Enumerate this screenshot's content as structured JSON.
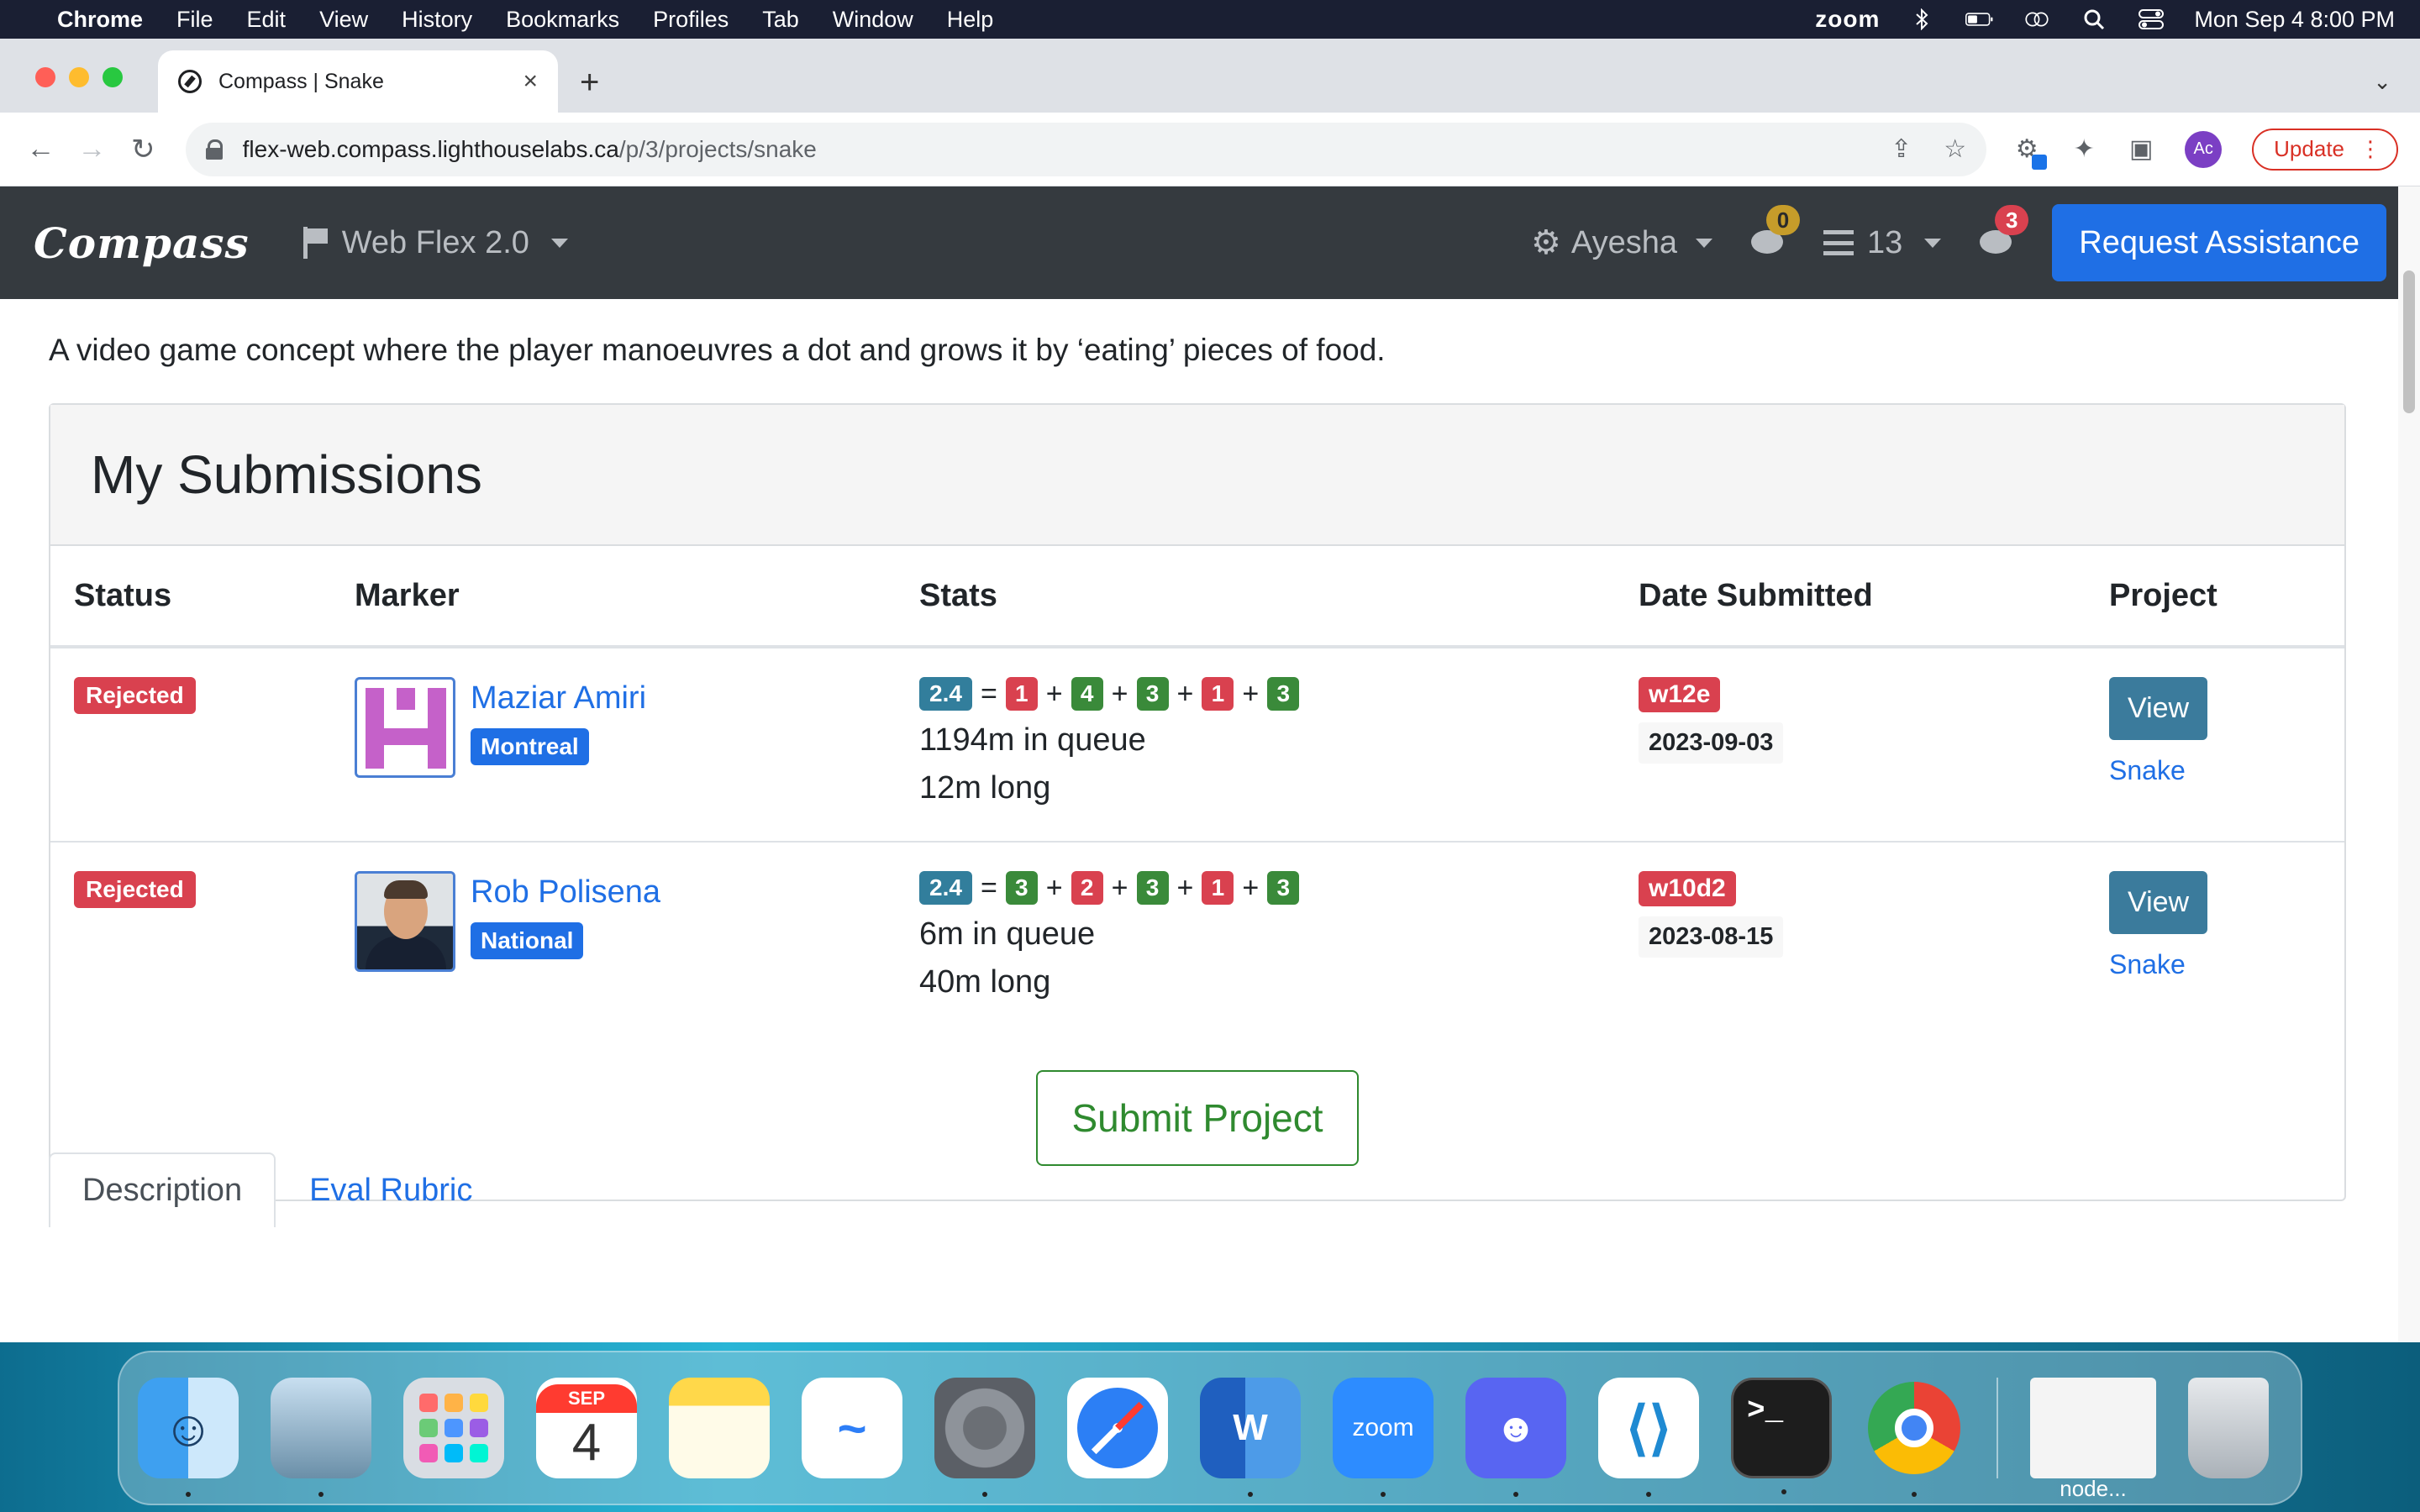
{
  "menubar": {
    "app_name": "Chrome",
    "items": [
      "File",
      "Edit",
      "View",
      "History",
      "Bookmarks",
      "Profiles",
      "Tab",
      "Window",
      "Help"
    ],
    "zoom": "zoom",
    "clock": "Mon Sep 4  8:00 PM"
  },
  "browser": {
    "tab_title": "Compass | Snake",
    "url_host": "flex-web.compass.lighthouselabs.ca",
    "url_path": "/p/3/projects/snake",
    "profile_initials": "Ac",
    "update_label": "Update"
  },
  "compass_nav": {
    "brand": "Compass",
    "cohort": "Web Flex 2.0",
    "user": "Ayesha",
    "notifications_count": "0",
    "queue_count": "13",
    "messages_count": "3",
    "request_label": "Request Assistance"
  },
  "project": {
    "description": "A video game concept where the player manoeuvres a dot and grows it by ‘eating’ pieces of food."
  },
  "submissions": {
    "title": "My Submissions",
    "columns": [
      "Status",
      "Marker",
      "Stats",
      "Date Submitted",
      "Project"
    ],
    "rows": [
      {
        "status": "Rejected",
        "marker_name": "Maziar Amiri",
        "marker_location": "Montreal",
        "total": "2.4",
        "scores": [
          "1",
          "4",
          "3",
          "1",
          "3"
        ],
        "score_colors": [
          "red",
          "green",
          "green",
          "red",
          "green"
        ],
        "queue": "1194m in queue",
        "duration": "12m long",
        "week": "w12e",
        "date": "2023-09-03",
        "view_label": "View",
        "project_link": "Snake"
      },
      {
        "status": "Rejected",
        "marker_name": "Rob Polisena",
        "marker_location": "National",
        "total": "2.4",
        "scores": [
          "3",
          "2",
          "3",
          "1",
          "3"
        ],
        "score_colors": [
          "green",
          "red",
          "green",
          "red",
          "green"
        ],
        "queue": "6m in queue",
        "duration": "40m long",
        "week": "w10d2",
        "date": "2023-08-15",
        "view_label": "View",
        "project_link": "Snake"
      }
    ],
    "submit_label": "Submit Project"
  },
  "tabs": {
    "description": "Description",
    "rubric": "Eval Rubric"
  },
  "dock": {
    "calendar_month": "SEP",
    "calendar_day": "4",
    "zoom_label": "zoom",
    "node_label": "node..."
  }
}
